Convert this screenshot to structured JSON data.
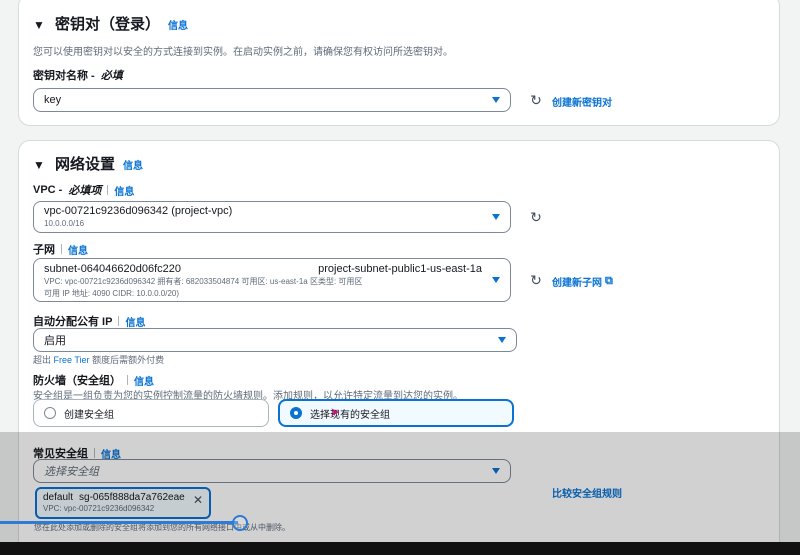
{
  "key_pair": {
    "title": "密钥对（登录）",
    "info": "信息",
    "description": "您可以使用密钥对以安全的方式连接到实例。在启动实例之前，请确保您有权访问所选密钥对。",
    "name_label": "密钥对名称 -",
    "name_required": "必填",
    "selected": "key",
    "create_link": "创建新密钥对"
  },
  "network": {
    "title": "网络设置",
    "info": "信息",
    "vpc": {
      "label": "VPC -",
      "required": "必填项",
      "info": "信息",
      "selected": "vpc-00721c9236d096342 (project-vpc)",
      "cidr": "10.0.0.0/16"
    },
    "subnet": {
      "label": "子网",
      "info": "信息",
      "id": "subnet-064046620d06fc220",
      "name": "project-subnet-public1-us-east-1a",
      "detail1": "VPC: vpc-00721c9236d096342    拥有者: 682033504874    可用区: us-east-1a    区类型: 可用区",
      "detail2": "可用 IP 地址: 4090    CIDR: 10.0.0.0/20)",
      "create_link": "创建新子网"
    },
    "public_ip": {
      "label": "自动分配公有 IP",
      "info": "信息",
      "selected": "启用",
      "hint_prefix": "超出",
      "hint_link": "Free Tier",
      "hint_suffix": "额度后需额外付费"
    },
    "firewall": {
      "label": "防火墙（安全组）",
      "info": "信息",
      "description": "安全组是一组负责为您的实例控制流量的防火墙规则。添加规则，以允许特定流量到达您的实例。",
      "option_create": "创建安全组",
      "option_existing": "选择现有的安全组"
    },
    "common_sg": {
      "label": "常见安全组",
      "info": "信息",
      "placeholder": "选择安全组",
      "compare_link": "比较安全组规则",
      "token_name": "default",
      "token_id": "sg-065f888da7a762eae",
      "token_vpc": "VPC: vpc-00721c9236d096342",
      "below_text": "您在此处添加或删除的安全组将添加到您的所有网络接口中或从中删除。"
    }
  },
  "video": {
    "progress": 0.3
  }
}
